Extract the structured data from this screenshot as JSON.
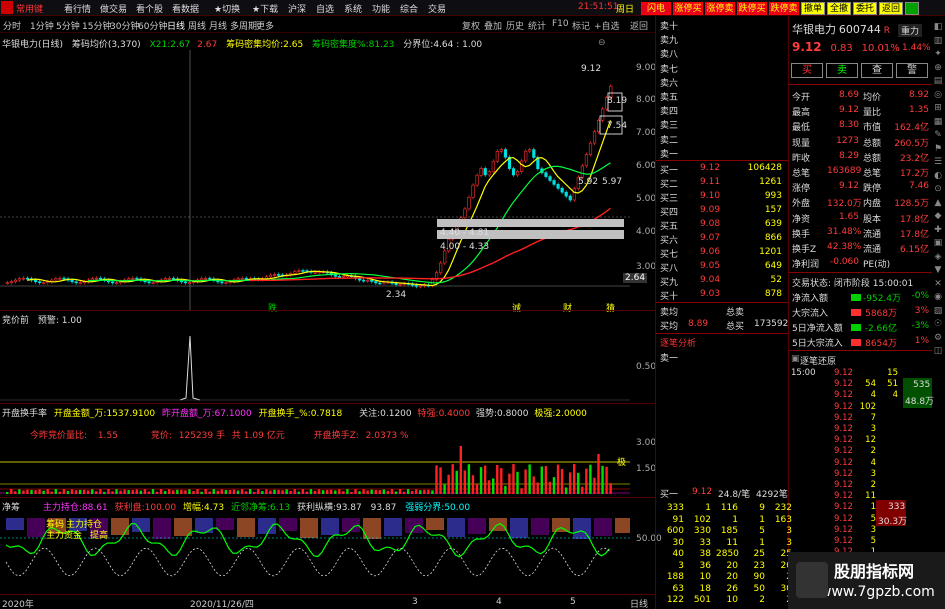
{
  "menubar": {
    "logo": "常用键",
    "items": [
      "看行情",
      "做交易",
      "看个股",
      "看数据",
      "★切换",
      "★下载",
      "沪深",
      "自选",
      "系统",
      "功能",
      "综合",
      "交易"
    ],
    "clock": "21:51:51",
    "date_label": "周日"
  },
  "top_buttons": [
    {
      "label": "闪电",
      "style": "red"
    },
    {
      "label": "涨停买",
      "style": "red"
    },
    {
      "label": "涨停卖",
      "style": "red"
    },
    {
      "label": "跌停买",
      "style": "red"
    },
    {
      "label": "跌停卖",
      "style": "red"
    },
    {
      "label": "撤单",
      "style": "yellow"
    },
    {
      "label": "全撤",
      "style": "yellow"
    },
    {
      "label": "委托",
      "style": "yellow"
    },
    {
      "label": "返回",
      "style": "yellow"
    },
    {
      "label": "",
      "style": "green"
    }
  ],
  "periodbar": {
    "items": [
      "分时",
      "1分钟",
      "5分钟",
      "15分钟",
      "30分钟",
      "60分钟",
      "日线",
      "周线",
      "月线",
      "多周期",
      "更多"
    ],
    "active": "日线",
    "right_tools": [
      "复权",
      "叠加",
      "历史",
      "统计",
      "F10",
      "标记",
      "+自选",
      "返回"
    ]
  },
  "main_chart": {
    "title": "华银电力(日线)",
    "indicator_name": "筹码均价(3,370)",
    "x21_label": "X21:",
    "x21_value": "2.67",
    "v2": "2.67",
    "cm_label": "筹码密集均价:",
    "cm_value": "2.65",
    "cmd_label": "筹码密集度%:",
    "cmd_value": "81.23",
    "div_label": "分界位:",
    "div_value": "4.64 : 1.00",
    "y_axis": [
      "9.00",
      "8.00",
      "7.00",
      "6.00",
      "5.00",
      "4.00",
      "3.00"
    ],
    "current_price_tag": "2.64",
    "annotations": {
      "high": "9.12",
      "p8": "8.19",
      "p7": "7.54",
      "p5_92": "5.92",
      "p5_97": "5.97",
      "range1": "4.40 - 4.81",
      "range2": "4.00 - 4.33",
      "low": "2.34"
    },
    "markers": [
      "跌",
      "诚",
      "财",
      "猜"
    ]
  },
  "panel2": {
    "title": "竞价前",
    "sub": "预警: 1.00",
    "y_axis": [
      "0.50"
    ]
  },
  "panel3": {
    "title": "开盘换手率",
    "items": [
      {
        "label": "开盘金额_万:",
        "value": "1537.9100",
        "color": "yellow"
      },
      {
        "label": "昨开盘额_万:",
        "value": "67.1000",
        "color": "magenta"
      },
      {
        "label": "开盘换手_%:",
        "value": "0.7818",
        "color": "yellow"
      },
      {
        "label": "关注:",
        "value": "0.1200",
        "color": "white"
      },
      {
        "label": "特强:",
        "value": "0.4000",
        "color": "red"
      },
      {
        "label": "强势:",
        "value": "0.8000",
        "color": "white"
      },
      {
        "label": "极强:",
        "value": "2.0000",
        "color": "yellow"
      }
    ],
    "line2": {
      "label1": "今昨竞价量比:",
      "v1": "1.55",
      "label2": "竞价:",
      "v2": "125239",
      "u2": "手",
      "label3": "共",
      "v3": "1.09",
      "u3": "亿元",
      "label4": "开盘换手Z:",
      "v4": "2.0373",
      "u4": "%"
    },
    "y_axis": [
      "3.00",
      "1.50"
    ],
    "right_marker": "极"
  },
  "panel4": {
    "title": "净筹",
    "items": [
      {
        "label": "主力持仓:",
        "value": "88.61",
        "color": "magenta"
      },
      {
        "label": "获利盘:",
        "value": "100.00",
        "color": "red"
      },
      {
        "label": "增幅:",
        "value": "4.73",
        "color": "yellow"
      },
      {
        "label": "近邻净筹:",
        "value": "6.13",
        "color": "green"
      },
      {
        "label": "获利纵横:",
        "value": "93.87",
        "color": "white"
      },
      {
        "label": "",
        "value": "93.87",
        "color": "white"
      },
      {
        "label": "强弱分界:",
        "value": "50.00",
        "color": "cyan"
      }
    ],
    "y_axis": [
      "50.00"
    ],
    "left_labels": [
      "筹码",
      "主力持仓",
      "主力资金",
      "提高"
    ]
  },
  "xaxis": {
    "labels": [
      "2020年",
      "2020/11/26/四",
      "3",
      "4",
      "5"
    ],
    "right": "日线"
  },
  "bottom_tabs": [
    "模板指标",
    "常用指标",
    "超买超卖",
    "均线",
    "技术指标",
    "能量",
    "主力"
  ],
  "ask_levels": [
    "卖十",
    "卖九",
    "卖八",
    "卖七",
    "卖六",
    "卖五",
    "卖四",
    "卖三",
    "卖二",
    "卖一"
  ],
  "bid_levels": [
    {
      "label": "买一",
      "price": "9.12",
      "vol": "106428"
    },
    {
      "label": "买二",
      "price": "9.11",
      "vol": "1261"
    },
    {
      "label": "买三",
      "price": "9.10",
      "vol": "993"
    },
    {
      "label": "买四",
      "price": "9.09",
      "vol": "157"
    },
    {
      "label": "买五",
      "price": "9.08",
      "vol": "639"
    },
    {
      "label": "买六",
      "price": "9.07",
      "vol": "866"
    },
    {
      "label": "买七",
      "price": "9.06",
      "vol": "1201"
    },
    {
      "label": "买八",
      "price": "9.05",
      "vol": "649"
    },
    {
      "label": "买九",
      "price": "9.04",
      "vol": "52"
    },
    {
      "label": "买十",
      "price": "9.03",
      "vol": "878"
    }
  ],
  "avg": {
    "label1": "卖均",
    "label2": "总卖",
    "label3": "买均",
    "v3": "8.89",
    "label4": "总买",
    "v4": "173592"
  },
  "analysis_title": "逐笔分析",
  "analysis_row": "卖一",
  "bottom_quote": {
    "label": "买一",
    "price": "9.12",
    "ratio": "24.8/笔",
    "vol": "4292笔"
  },
  "queue": [
    [
      "333",
      "1",
      "116",
      "9",
      "232"
    ],
    [
      "91",
      "102",
      "1",
      "1",
      "163"
    ],
    [
      "600",
      "330",
      "185",
      "5",
      "3"
    ],
    [
      "30",
      "33",
      "11",
      "1",
      "3"
    ],
    [
      "40",
      "38",
      "2850",
      "25",
      "25"
    ],
    [
      "3",
      "36",
      "20",
      "23",
      "20"
    ],
    [
      "188",
      "10",
      "20",
      "90",
      "2"
    ],
    [
      "63",
      "18",
      "26",
      "50",
      "30"
    ],
    [
      "122",
      "501",
      "10",
      "2",
      "2"
    ]
  ],
  "stock": {
    "name": "华银电力",
    "code": "600744",
    "flag": "R",
    "price": "9.12",
    "change": "0.83",
    "pct": "10.01%",
    "side_label": "重力",
    "side_pct": "1.44%"
  },
  "trade_buttons": [
    "买",
    "卖",
    "查",
    "警"
  ],
  "info": [
    [
      "今开",
      "8.69",
      "均价",
      "8.92"
    ],
    [
      "最高",
      "9.12",
      "量比",
      "1.35"
    ],
    [
      "最低",
      "8.30",
      "市值",
      "162.4亿"
    ],
    [
      "现量",
      "1273",
      "总额",
      "260.5万"
    ],
    [
      "昨收",
      "8.29",
      "总额",
      "23.2亿"
    ],
    [
      "总笔",
      "163689",
      "总笔",
      "17.2万"
    ],
    [
      "涨停",
      "9.12",
      "跌停",
      "7.46"
    ],
    [
      "外盘",
      "132.0万",
      "内盘",
      "128.5万"
    ],
    [
      "净资",
      "1.65",
      "股本",
      "17.8亿"
    ],
    [
      "换手",
      "31.48%",
      "流通",
      "17.8亿"
    ],
    [
      "换手Z",
      "42.38%",
      "流通",
      "6.15亿"
    ],
    [
      "净利润",
      "-0.060",
      "PE(动)",
      ""
    ]
  ],
  "trade_status": "交易状态: 闭市阶段 15:00:01",
  "flows": [
    {
      "label": "净流入额",
      "value": "-952.4万",
      "pct": "-0%",
      "color": "green"
    },
    {
      "label": "大宗流入",
      "value": "5868万",
      "pct": "3%",
      "color": "red"
    },
    {
      "label": "5日净流入额",
      "value": "-2.66亿",
      "pct": "-3%",
      "color": "green"
    },
    {
      "label": "5日大宗流入",
      "value": "8654万",
      "pct": "1%",
      "color": "red"
    }
  ],
  "tick_title": "逐笔还原",
  "ticks": [
    [
      "15:00",
      "9.12",
      "",
      "15",
      "4"
    ],
    [
      "",
      "9.12",
      "54",
      "51",
      ""
    ],
    [
      "",
      "9.12",
      "4",
      "4",
      "4"
    ],
    [
      "",
      "9.12",
      "102",
      ""
    ],
    [
      "",
      "9.12",
      "7",
      ""
    ],
    [
      "",
      "9.12",
      "3",
      ""
    ],
    [
      "",
      "9.12",
      "12",
      ""
    ],
    [
      "",
      "9.12",
      "2",
      ""
    ],
    [
      "",
      "9.12",
      "4",
      ""
    ],
    [
      "",
      "9.12",
      "3",
      ""
    ],
    [
      "",
      "9.12",
      "2",
      ""
    ],
    [
      "",
      "9.12",
      "11",
      ""
    ],
    [
      "",
      "9.12",
      "1",
      ""
    ],
    [
      "",
      "9.12",
      "5",
      ""
    ],
    [
      "",
      "9.12",
      "3",
      ""
    ],
    [
      "",
      "9.12",
      "5",
      ""
    ],
    [
      "",
      "9.12",
      "1",
      ""
    ],
    [
      "",
      "9.12",
      "6",
      ""
    ],
    [
      "",
      "9.12",
      "2",
      ""
    ],
    [
      "",
      "9.12",
      "2",
      ""
    ]
  ],
  "tick_side": {
    "top": "535",
    "mid": "48.8万",
    "bottom_vol": "333",
    "bottom_amt": "30.3万"
  },
  "watermark": {
    "line1": "股朋指标网",
    "line2": "www.7gpzb.com"
  }
}
